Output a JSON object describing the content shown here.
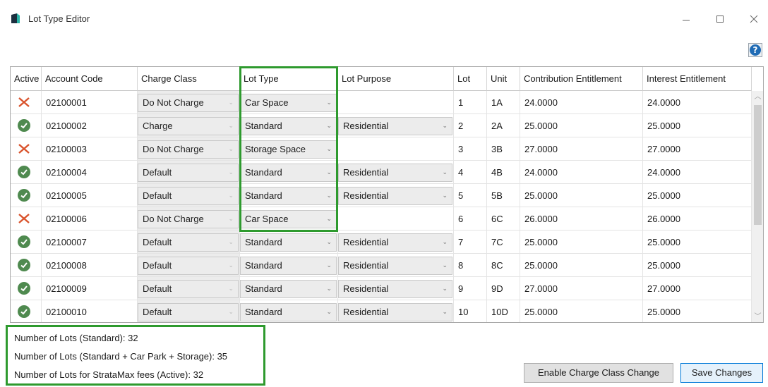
{
  "window": {
    "title": "Lot Type Editor",
    "minimize_glyph": "—",
    "maximize_glyph": "☐",
    "close_glyph": "✕",
    "help_glyph": "?"
  },
  "grid": {
    "columns": [
      "Active",
      "Account Code",
      "Charge Class",
      "Lot Type",
      "Lot Purpose",
      "Lot",
      "Unit",
      "Contribution Entitlement",
      "Interest Entitlement"
    ],
    "rows": [
      {
        "active": false,
        "account_code": "02100001",
        "charge_class": "Do Not Charge",
        "lot_type": "Car Space",
        "lot_purpose": "",
        "lot": "1",
        "unit": "1A",
        "contribution": "24.0000",
        "interest": "24.0000"
      },
      {
        "active": true,
        "account_code": "02100002",
        "charge_class": "Charge",
        "lot_type": "Standard",
        "lot_purpose": "Residential",
        "lot": "2",
        "unit": "2A",
        "contribution": "25.0000",
        "interest": "25.0000"
      },
      {
        "active": false,
        "account_code": "02100003",
        "charge_class": "Do Not Charge",
        "lot_type": "Storage Space",
        "lot_purpose": "",
        "lot": "3",
        "unit": "3B",
        "contribution": "27.0000",
        "interest": "27.0000"
      },
      {
        "active": true,
        "account_code": "02100004",
        "charge_class": "Default",
        "lot_type": "Standard",
        "lot_purpose": "Residential",
        "lot": "4",
        "unit": "4B",
        "contribution": "24.0000",
        "interest": "24.0000"
      },
      {
        "active": true,
        "account_code": "02100005",
        "charge_class": "Default",
        "lot_type": "Standard",
        "lot_purpose": "Residential",
        "lot": "5",
        "unit": "5B",
        "contribution": "25.0000",
        "interest": "25.0000"
      },
      {
        "active": false,
        "account_code": "02100006",
        "charge_class": "Do Not Charge",
        "lot_type": "Car Space",
        "lot_purpose": "",
        "lot": "6",
        "unit": "6C",
        "contribution": "26.0000",
        "interest": "26.0000"
      },
      {
        "active": true,
        "account_code": "02100007",
        "charge_class": "Default",
        "lot_type": "Standard",
        "lot_purpose": "Residential",
        "lot": "7",
        "unit": "7C",
        "contribution": "25.0000",
        "interest": "25.0000"
      },
      {
        "active": true,
        "account_code": "02100008",
        "charge_class": "Default",
        "lot_type": "Standard",
        "lot_purpose": "Residential",
        "lot": "8",
        "unit": "8C",
        "contribution": "25.0000",
        "interest": "25.0000"
      },
      {
        "active": true,
        "account_code": "02100009",
        "charge_class": "Default",
        "lot_type": "Standard",
        "lot_purpose": "Residential",
        "lot": "9",
        "unit": "9D",
        "contribution": "27.0000",
        "interest": "27.0000"
      },
      {
        "active": true,
        "account_code": "02100010",
        "charge_class": "Default",
        "lot_type": "Standard",
        "lot_purpose": "Residential",
        "lot": "10",
        "unit": "10D",
        "contribution": "25.0000",
        "interest": "25.0000"
      }
    ]
  },
  "summary": {
    "standard": "Number of Lots (Standard):  32",
    "all": "Number of Lots (Standard + Car Park + Storage):  35",
    "active": "Number of Lots for StrataMax fees (Active):  32"
  },
  "buttons": {
    "enable_charge_class": "Enable Charge Class Change",
    "save_changes": "Save Changes"
  },
  "colors": {
    "highlight": "#2e9a2e",
    "inactive_x": "#d9532c",
    "active_check": "#4f8a4f"
  }
}
